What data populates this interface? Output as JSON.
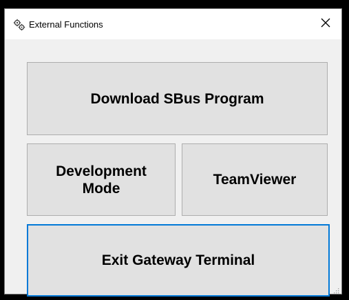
{
  "window": {
    "title": "External Functions",
    "app_icon": "gears-icon",
    "close_icon": "close-icon",
    "close_glyph": "✕"
  },
  "buttons": {
    "download_sbus": "Download SBus Program",
    "development_mode": "Development\nMode",
    "teamviewer": "TeamViewer",
    "exit_gateway": "Exit Gateway Terminal"
  },
  "colors": {
    "focus_border": "#0078d7",
    "button_face": "#e1e1e1",
    "window_bg": "#f0f0f0"
  }
}
